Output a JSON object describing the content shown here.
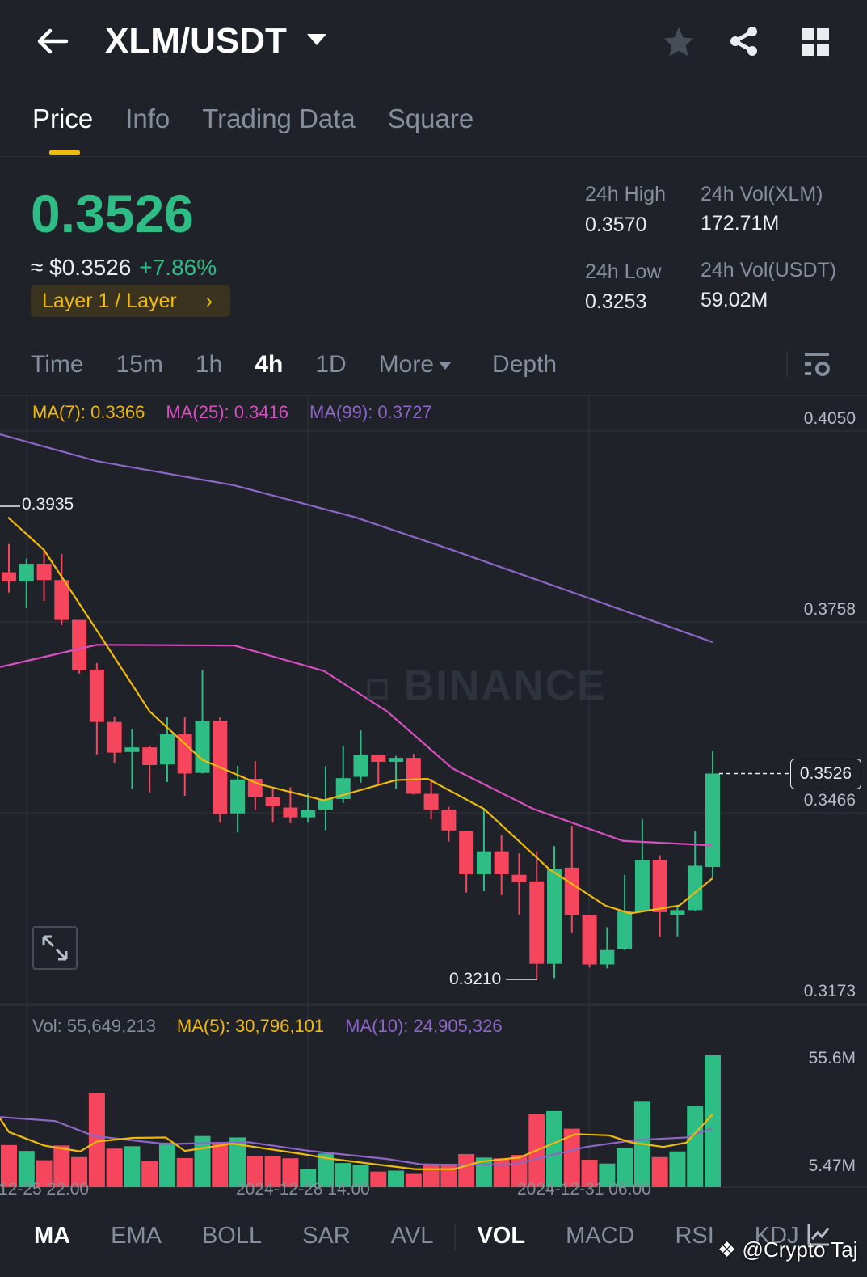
{
  "header": {
    "title": "XLM/USDT",
    "icons": [
      "back-arrow-icon",
      "star-icon",
      "share-icon",
      "grid-icon"
    ]
  },
  "tabs": [
    "Price",
    "Info",
    "Trading Data",
    "Square"
  ],
  "ticker": {
    "last": "0.3526",
    "usd": "≈ $0.3526",
    "change": "+7.86%",
    "tag": "Layer 1 / Layer",
    "tag_arrow": "›",
    "stats": [
      {
        "label": "24h High",
        "value": "0.3570"
      },
      {
        "label": "24h Vol(XLM)",
        "value": "172.71M"
      },
      {
        "label": "24h Low",
        "value": "0.3253"
      },
      {
        "label": "24h Vol(USDT)",
        "value": "59.02M"
      }
    ]
  },
  "intervals": [
    "Time",
    "15m",
    "1h",
    "4h",
    "1D",
    "More",
    "Depth"
  ],
  "active_interval": "4h",
  "ma_legend": {
    "ma7": "MA(7): 0.3366",
    "ma25": "MA(25): 0.3416",
    "ma99": "MA(99): 0.3727"
  },
  "vol_legend": {
    "vol": "Vol: 55,649,213",
    "ma5": "MA(5): 30,796,101",
    "ma10": "MA(10): 24,905,326"
  },
  "watermark": "BINANCE",
  "credit": "@Crypto Taj",
  "bottom_tabs": [
    "MA",
    "EMA",
    "BOLL",
    "SAR",
    "AVL",
    "VOL",
    "MACD",
    "RSI",
    "KDJ"
  ],
  "colors": {
    "up": "#2ebd85",
    "down": "#f6465d",
    "ma7": "#f0b90b",
    "ma25": "#d84fc0",
    "ma99": "#8e66c7",
    "accent": "#f0b90b"
  },
  "chart_data": {
    "type": "candlestick",
    "interval": "4h",
    "price_ticks": [
      "0.4050",
      "0.3758",
      "0.3466",
      "0.3173"
    ],
    "volume_ticks": [
      "55.6M",
      "5.47M"
    ],
    "x_ticks": [
      "12-25 22:00",
      "2024-12-28 14:00",
      "2024-12-31 06:00"
    ],
    "high_marker": "0.3935",
    "low_marker": "0.3210",
    "last_price": "0.3526",
    "ohlc": [
      [
        0.3834,
        0.3877,
        0.3803,
        0.382
      ],
      [
        0.382,
        0.3855,
        0.3779,
        0.3847
      ],
      [
        0.3847,
        0.3867,
        0.379,
        0.3822
      ],
      [
        0.3822,
        0.3862,
        0.3753,
        0.3761
      ],
      [
        0.3761,
        0.3761,
        0.3679,
        0.3684
      ],
      [
        0.3685,
        0.3695,
        0.3555,
        0.3605
      ],
      [
        0.3605,
        0.3613,
        0.3542,
        0.3558
      ],
      [
        0.3559,
        0.3594,
        0.3502,
        0.3566
      ],
      [
        0.3566,
        0.3569,
        0.3497,
        0.3539
      ],
      [
        0.354,
        0.3612,
        0.3513,
        0.3586
      ],
      [
        0.3586,
        0.3612,
        0.3492,
        0.3526
      ],
      [
        0.3527,
        0.3684,
        0.3526,
        0.3606
      ],
      [
        0.3607,
        0.3612,
        0.3451,
        0.3464
      ],
      [
        0.3465,
        0.3538,
        0.3436,
        0.3517
      ],
      [
        0.3518,
        0.3545,
        0.3471,
        0.349
      ],
      [
        0.349,
        0.3502,
        0.3451,
        0.3476
      ],
      [
        0.3474,
        0.3505,
        0.345,
        0.3459
      ],
      [
        0.3459,
        0.3495,
        0.3451,
        0.347
      ],
      [
        0.3471,
        0.3537,
        0.3439,
        0.3487
      ],
      [
        0.3487,
        0.3568,
        0.3481,
        0.3519
      ],
      [
        0.3521,
        0.3592,
        0.3512,
        0.3555
      ],
      [
        0.3555,
        0.3555,
        0.3508,
        0.3544
      ],
      [
        0.3544,
        0.3553,
        0.3503,
        0.355
      ],
      [
        0.355,
        0.3556,
        0.3494,
        0.3495
      ],
      [
        0.3495,
        0.3518,
        0.3456,
        0.3471
      ],
      [
        0.3471,
        0.3475,
        0.3422,
        0.3439
      ],
      [
        0.3438,
        0.3438,
        0.3344,
        0.3372
      ],
      [
        0.3372,
        0.3472,
        0.3346,
        0.3407
      ],
      [
        0.3407,
        0.3432,
        0.334,
        0.3372
      ],
      [
        0.3371,
        0.3404,
        0.331,
        0.336
      ],
      [
        0.3361,
        0.3407,
        0.321,
        0.3235
      ],
      [
        0.3235,
        0.3415,
        0.3213,
        0.338
      ],
      [
        0.3382,
        0.3446,
        0.3282,
        0.3309
      ],
      [
        0.3309,
        0.3309,
        0.3229,
        0.3234
      ],
      [
        0.3234,
        0.3291,
        0.3228,
        0.3256
      ],
      [
        0.3257,
        0.3371,
        0.3256,
        0.3315
      ],
      [
        0.3315,
        0.3456,
        0.3314,
        0.3394
      ],
      [
        0.3394,
        0.3401,
        0.3276,
        0.3314
      ],
      [
        0.331,
        0.3325,
        0.3277,
        0.3317
      ],
      [
        0.3317,
        0.3438,
        0.3315,
        0.3385
      ],
      [
        0.3383,
        0.3561,
        0.3367,
        0.3526
      ]
    ],
    "volume_m": [
      17.8,
      15.3,
      11.4,
      17.6,
      12.7,
      39.8,
      16.3,
      17.3,
      11.0,
      18.8,
      12.3,
      21.6,
      18.8,
      21.0,
      13.3,
      13.3,
      12.2,
      7.6,
      14.2,
      10.2,
      9.4,
      6.6,
      7.0,
      5.6,
      9.7,
      9.9,
      14.0,
      12.5,
      12.2,
      13.6,
      30.7,
      32.1,
      24.7,
      11.6,
      10.0,
      16.7,
      36.4,
      12.7,
      15.1,
      34.1,
      55.6
    ],
    "ma7": [
      [
        -0.05,
        0.3918
      ],
      [
        2,
        0.3868
      ],
      [
        5,
        0.3745
      ],
      [
        8,
        0.3621
      ],
      [
        11,
        0.3547
      ],
      [
        14.2,
        0.351
      ],
      [
        17.9,
        0.3485
      ],
      [
        22,
        0.3516
      ],
      [
        23.8,
        0.3518
      ],
      [
        27,
        0.3472
      ],
      [
        30.7,
        0.338
      ],
      [
        33.9,
        0.3324
      ],
      [
        35.3,
        0.3312
      ],
      [
        38.1,
        0.3324
      ],
      [
        40,
        0.3366
      ]
    ],
    "ma25": [
      [
        -0.5,
        0.3689
      ],
      [
        5,
        0.3723
      ],
      [
        12.8,
        0.3722
      ],
      [
        17.9,
        0.3683
      ],
      [
        21.5,
        0.3621
      ],
      [
        25.2,
        0.3534
      ],
      [
        29.8,
        0.3472
      ],
      [
        34.9,
        0.3423
      ],
      [
        40,
        0.3416
      ]
    ],
    "ma99": [
      [
        -0.5,
        0.4045
      ],
      [
        5,
        0.4004
      ],
      [
        12.8,
        0.3967
      ],
      [
        19.7,
        0.3918
      ],
      [
        25.2,
        0.3868
      ],
      [
        33,
        0.3794
      ],
      [
        40,
        0.3727
      ]
    ],
    "vol_ma5": [
      [
        -0.5,
        29.0
      ],
      [
        0,
        23.3
      ],
      [
        2,
        17.6
      ],
      [
        4.05,
        15.1
      ],
      [
        5,
        19.3
      ],
      [
        7.04,
        20.8
      ],
      [
        8.92,
        21.0
      ],
      [
        10,
        15.3
      ],
      [
        12.7,
        18.4
      ],
      [
        16.5,
        14.2
      ],
      [
        18.4,
        11.9
      ],
      [
        23.1,
        7.6
      ],
      [
        25.3,
        7.6
      ],
      [
        26.8,
        10.8
      ],
      [
        29,
        12.5
      ],
      [
        32.2,
        22.4
      ],
      [
        34.1,
        21.9
      ],
      [
        35.3,
        19.0
      ],
      [
        37.2,
        17.0
      ],
      [
        38.5,
        18.8
      ],
      [
        40,
        30.8
      ]
    ],
    "vol_ma10": [
      [
        -0.5,
        29.6
      ],
      [
        2.64,
        27.9
      ],
      [
        4.84,
        21.6
      ],
      [
        8.92,
        18.2
      ],
      [
        13.64,
        19.0
      ],
      [
        17.1,
        15.3
      ],
      [
        21.5,
        11.9
      ],
      [
        23.4,
        9.7
      ],
      [
        25.6,
        9.4
      ],
      [
        28.7,
        9.7
      ],
      [
        32.8,
        17.0
      ],
      [
        35.6,
        19.9
      ],
      [
        38.5,
        21.0
      ],
      [
        40,
        24.9
      ]
    ]
  }
}
